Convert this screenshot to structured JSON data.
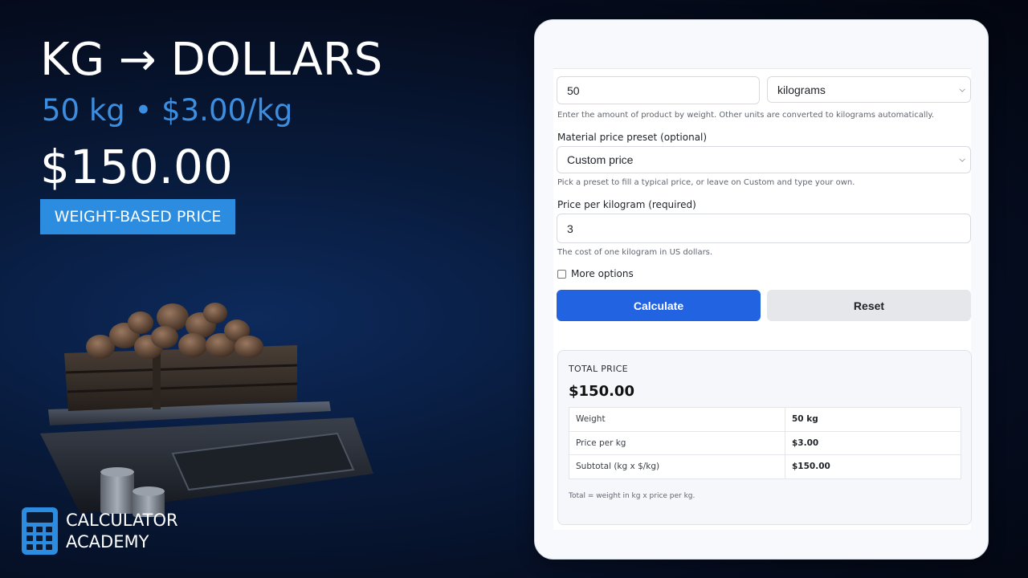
{
  "hero": {
    "title": "KG → DOLLARS",
    "subtitle": "50 kg • $3.00/kg",
    "total": "$150.00",
    "badge": "WEIGHT-BASED PRICE"
  },
  "brand": {
    "line1": "CALCULATOR",
    "line2": "ACADEMY",
    "icon": "calculator-icon",
    "color": "#2b8ce0"
  },
  "form": {
    "weight_value": "50",
    "weight_unit": "kilograms",
    "weight_help": "Enter the amount of product by weight. Other units are converted to kilograms automatically.",
    "preset_label": "Material price preset (optional)",
    "preset_value": "Custom price",
    "preset_help": "Pick a preset to fill a typical price, or leave on Custom and type your own.",
    "price_label": "Price per kilogram (required)",
    "price_value": "3",
    "price_help": "The cost of one kilogram in US dollars.",
    "more_options_label": "More options",
    "more_options_checked": false,
    "calculate_label": "Calculate",
    "reset_label": "Reset"
  },
  "result": {
    "label": "TOTAL PRICE",
    "total": "$150.00",
    "rows": [
      {
        "name": "Weight",
        "value": "50 kg"
      },
      {
        "name": "Price per kg",
        "value": "$3.00"
      },
      {
        "name": "Subtotal (kg x $/kg)",
        "value": "$150.00"
      }
    ],
    "note": "Total = weight in kg x price per kg."
  },
  "colors": {
    "accent": "#2b8ce0",
    "primary_button": "#2163e0",
    "background": "#050c1e"
  }
}
